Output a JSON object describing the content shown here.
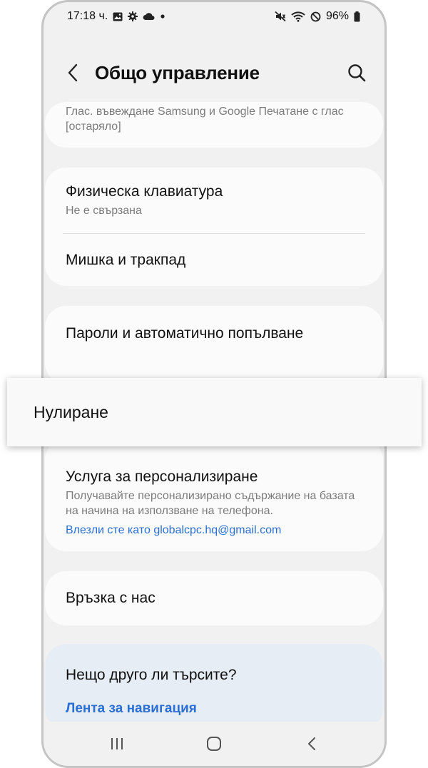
{
  "status_bar": {
    "time": "17:18 ч.",
    "battery_percent": "96%",
    "icons": [
      "gallery-icon",
      "gear-icon",
      "cloud-icon",
      "dot-icon",
      "mute-icon",
      "wifi-icon",
      "do-not-disturb-icon",
      "battery-icon"
    ]
  },
  "header": {
    "title": "Общо управление"
  },
  "items": {
    "samsung_voice_subtitle": "Глас. въвеждане Samsung и Google Печатане с глас [остаряло]",
    "physical_keyboard_title": "Физическа клавиатура",
    "physical_keyboard_subtitle": "Не е свързана",
    "mouse_trackpad_title": "Мишка и тракпад",
    "passwords_title": "Пароли и автоматично попълване",
    "reset_title": "Нулиране",
    "personalization_title": "Услуга за персонализиране",
    "personalization_subtitle": "Получавайте персонализирано съдържание на базата на начина на използване на телефона.",
    "personalization_account": "Влезли сте като globalcpc.hq@gmail.com",
    "contact_title": "Връзка с нас"
  },
  "looking_for": {
    "title": "Нещо друго ли търсите?",
    "link": "Лента за навигация"
  },
  "nav_bar": {
    "icons": [
      "recent-apps-icon",
      "home-icon",
      "back-icon"
    ]
  },
  "colors": {
    "accent_link": "#2a6fd6",
    "background": "#f1f1f1",
    "card": "#fbfbfb",
    "suggestion_card": "#e6edf4"
  }
}
